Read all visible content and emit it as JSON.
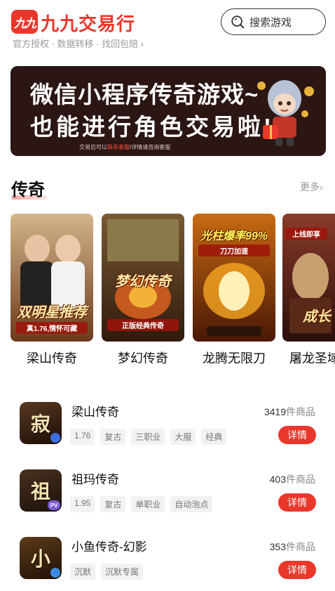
{
  "header": {
    "logo_mark": "九九",
    "logo_text": "九九交易行",
    "tagline": "官方授权 · 数据转移 · 找回包赔 ›",
    "search_placeholder": "搜索游戏"
  },
  "banner": {
    "line1": "微信小程序传奇游戏~",
    "line2": "也能进行角色交易啦!",
    "note_prefix": "交易后可以",
    "note_highlight": "联系客服",
    "note_suffix": "/详情请咨询客服"
  },
  "section": {
    "title": "传奇",
    "more": "更多›"
  },
  "cards": [
    {
      "label": "梁山传奇",
      "art_title": "双明星推荐",
      "art_sub": "真1.76,情怀可藏",
      "colors": [
        "#d4b58a",
        "#6b3a1c"
      ]
    },
    {
      "label": "梦幻传奇",
      "art_title": "梦幻传奇",
      "art_sub": "正版经典传奇",
      "colors": [
        "#7a5a34",
        "#2f1a0c"
      ]
    },
    {
      "label": "龙腾无限刀",
      "art_title": "光柱爆率99%",
      "art_sub": "刀刀加速",
      "colors": [
        "#c86a12",
        "#4a1806"
      ]
    },
    {
      "label": "屠龙圣域",
      "art_title": "成长",
      "art_sub": "上线即享",
      "colors": [
        "#8a3b2a",
        "#2a0f0a"
      ]
    }
  ],
  "games": [
    {
      "name": "梁山传奇",
      "count": "3419",
      "unit": "件商品",
      "tags": [
        "1.76",
        "复古",
        "三职业",
        "大服",
        "经典"
      ],
      "icon_glyph": "寂",
      "badge": "",
      "detail": "详情",
      "icon_colors": [
        "#5a3a22",
        "#1a0d06"
      ]
    },
    {
      "name": "祖玛传奇",
      "count": "403",
      "unit": "件商品",
      "tags": [
        "1.95",
        "复古",
        "单职业",
        "自动泡点"
      ],
      "icon_glyph": "祖",
      "badge": "PV",
      "detail": "详情",
      "icon_colors": [
        "#4a3020",
        "#1c120a"
      ]
    },
    {
      "name": "小鱼传奇-幻影",
      "count": "353",
      "unit": "件商品",
      "tags": [
        "沉默",
        "沉默专属"
      ],
      "icon_glyph": "小",
      "badge": "",
      "detail": "详情",
      "icon_colors": [
        "#5c3b1a",
        "#201006"
      ]
    }
  ]
}
